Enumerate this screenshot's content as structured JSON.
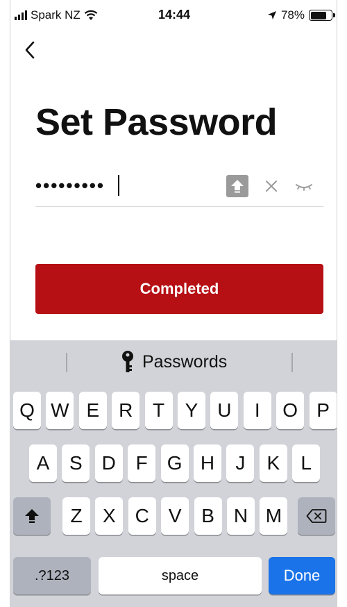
{
  "status_bar": {
    "carrier": "Spark NZ",
    "time": "14:44",
    "battery_percent": "78%",
    "battery_level": 0.78
  },
  "header": {
    "back_icon": "chevron-left-icon"
  },
  "page": {
    "title": "Set Password"
  },
  "password_field": {
    "masked_value": "•••••••••",
    "icons": [
      "capslock-icon",
      "clear-icon",
      "hide-password-icon"
    ]
  },
  "primary_action": {
    "label": "Completed",
    "color": "#b61015"
  },
  "keyboard": {
    "suggestion_label": "Passwords",
    "suggestion_icon": "key-icon",
    "row1": [
      "Q",
      "W",
      "E",
      "R",
      "T",
      "Y",
      "U",
      "I",
      "O",
      "P"
    ],
    "row2": [
      "A",
      "S",
      "D",
      "F",
      "G",
      "H",
      "J",
      "K",
      "L"
    ],
    "row3": [
      "Z",
      "X",
      "C",
      "V",
      "B",
      "N",
      "M"
    ],
    "shift_icon": "shift-icon",
    "backspace_icon": "backspace-icon",
    "numbers_label": ".?123",
    "space_label": "space",
    "done_label": "Done",
    "done_color": "#1a73e8"
  }
}
